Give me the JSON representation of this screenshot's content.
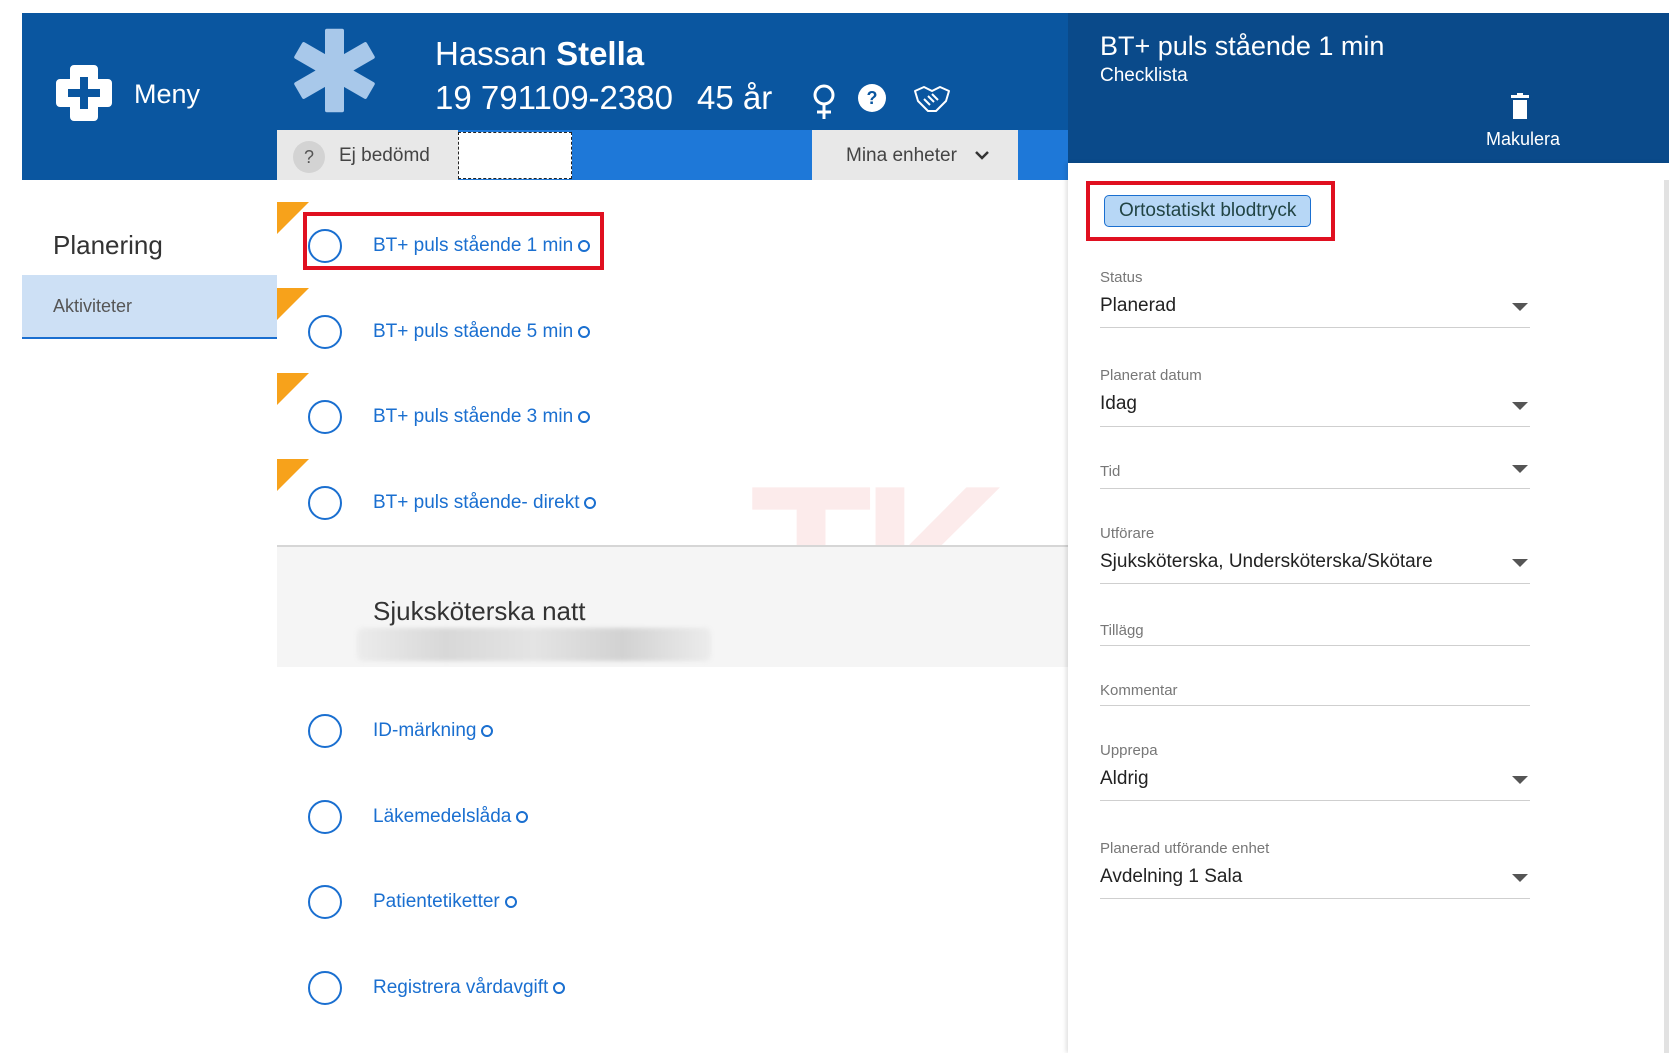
{
  "menu": {
    "label": "Meny"
  },
  "sidebar": {
    "title": "Planering",
    "items": [
      {
        "label": "Aktiviteter"
      }
    ]
  },
  "patient": {
    "first_name": "Hassan",
    "last_name": "Stella",
    "personal_id": "19 791109-2380",
    "age": "45 år"
  },
  "assessment": {
    "icon": "?",
    "label": "Ej bedömd"
  },
  "units_button": {
    "label": "Mina enheter"
  },
  "activities": [
    {
      "label": "BT+ puls stående 1 min",
      "flag": true
    },
    {
      "label": "BT+ puls stående 5 min",
      "flag": true
    },
    {
      "label": "BT+ puls stående 3 min",
      "flag": true
    },
    {
      "label": "BT+ puls stående- direkt",
      "flag": true
    }
  ],
  "section": {
    "title": "Sjuksköterska natt"
  },
  "section_activities": [
    {
      "label": "ID-märkning"
    },
    {
      "label": "Läkemedelslåda"
    },
    {
      "label": "Patientetiketter"
    },
    {
      "label": "Registrera vårdavgift"
    }
  ],
  "watermark": "TK",
  "panel": {
    "title": "BT+ puls stående 1 min",
    "subtitle": "Checklista",
    "delete_label": "Makulera",
    "tag": "Ortostatiskt blodtryck",
    "fields": {
      "status": {
        "label": "Status",
        "value": "Planerad"
      },
      "date": {
        "label": "Planerat datum",
        "value": "Idag"
      },
      "time": {
        "label": "Tid",
        "value": ""
      },
      "performer": {
        "label": "Utförare",
        "value": "Sjuksköterska, Undersköterska/Skötare"
      },
      "addition": {
        "label": "Tillägg",
        "value": ""
      },
      "comment": {
        "label": "Kommentar",
        "value": ""
      },
      "repeat": {
        "label": "Upprepa",
        "value": "Aldrig"
      },
      "unit": {
        "label": "Planerad utförande enhet",
        "value": "Avdelning 1 Sala"
      }
    }
  },
  "colors": {
    "brand_blue": "#0a56a0",
    "panel_blue": "#0a4a8a",
    "link_blue": "#1a6fd0",
    "flag_orange": "#f7a21b",
    "highlight_red": "#e01020"
  }
}
